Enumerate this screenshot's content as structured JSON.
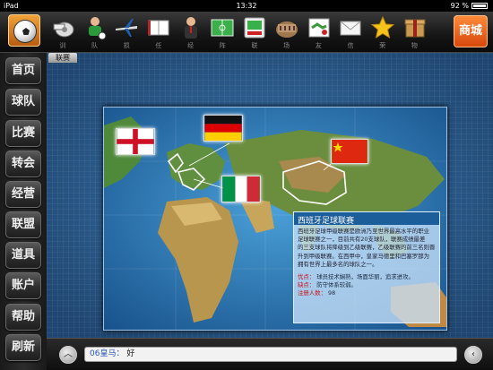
{
  "status_bar": {
    "device": "iPad",
    "time": "13:32",
    "battery": "92 %"
  },
  "topbar": {
    "logo": "soccer-ball-icon",
    "tools": [
      {
        "label": "训",
        "icon": "whistle-icon"
      },
      {
        "label": "队",
        "icon": "player-icon"
      },
      {
        "label": "损",
        "icon": "airplane-icon"
      },
      {
        "label": "任",
        "icon": "book-icon"
      },
      {
        "label": "经",
        "icon": "manager-icon"
      },
      {
        "label": "阵",
        "icon": "pitch-icon"
      },
      {
        "label": "联",
        "icon": "league-icon"
      },
      {
        "label": "场",
        "icon": "colosseum-icon"
      },
      {
        "label": "友",
        "icon": "handshake-icon"
      },
      {
        "label": "信",
        "icon": "mail-icon"
      },
      {
        "label": "荣",
        "icon": "star-icon"
      },
      {
        "label": "物",
        "icon": "box-icon"
      }
    ],
    "shop_label": "商城"
  },
  "sidebar": {
    "items": [
      {
        "label": "首页"
      },
      {
        "label": "球队"
      },
      {
        "label": "比赛"
      },
      {
        "label": "转会"
      },
      {
        "label": "经营"
      },
      {
        "label": "联盟"
      },
      {
        "label": "道具"
      },
      {
        "label": "账户"
      },
      {
        "label": "帮助"
      },
      {
        "label": "刷新"
      }
    ]
  },
  "main": {
    "tab_label": "联赛",
    "flags": [
      "england-flag",
      "germany-flag",
      "italy-flag",
      "china-flag"
    ],
    "info": {
      "title": "西班牙足球联赛",
      "description_lines": [
        "西班牙足球甲级联赛是欧洲乃至世界最高水平的职业",
        "足球联赛之一，目前共有20支球队，联赛成绩最差",
        "的三支球队将降级到乙级联赛，乙级联赛的前三名则晋",
        "升到甲级联赛。在西甲中，皇家马德里和巴塞罗那为",
        "拥有世界上最多名的球队之一。"
      ],
      "pros_label": "优点",
      "pros": "球员技术娴熟，场面华丽，追求进攻。",
      "cons_label": "缺点",
      "cons": "防守体系较弱。",
      "count_label": "注册人数",
      "count": "98"
    }
  },
  "chat": {
    "sender": "06皇马",
    "message": "好"
  },
  "colors": {
    "shop": "#e8601c",
    "title_bar": "#1c5e9a",
    "map_bg": "#2d5e92"
  }
}
